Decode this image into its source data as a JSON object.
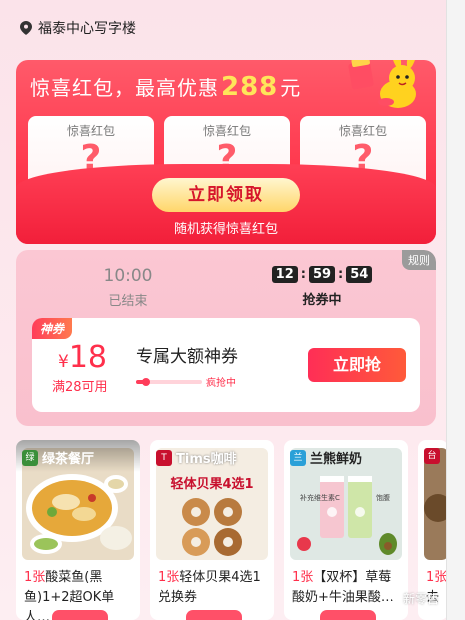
{
  "location": {
    "name": "福泰中心写字楼"
  },
  "red_packet": {
    "title_prefix": "惊喜红包，最高优惠",
    "amount": "288",
    "unit": "元",
    "slots": [
      {
        "label": "惊喜红包",
        "mystery": "?"
      },
      {
        "label": "惊喜红包",
        "mystery": "?"
      },
      {
        "label": "惊喜红包",
        "mystery": "?"
      }
    ],
    "claim_button": "立即领取",
    "subtitle": "随机获得惊喜红包"
  },
  "coupon_section": {
    "rules_label": "规则",
    "slots": [
      {
        "time": "10:00",
        "status": "已结束"
      },
      {
        "clock": [
          "12",
          "59",
          "54"
        ],
        "status": "抢券中"
      }
    ],
    "coupon": {
      "badge": "神券",
      "currency": "¥",
      "amount": "18",
      "condition": "满28可用",
      "title": "专属大额神券",
      "progress_label": "疯抢中",
      "progress_fraction": 0.15,
      "grab_button": "立即抢"
    }
  },
  "products": [
    {
      "brand": "绿茶餐厅",
      "count": "1张",
      "desc": "酸菜鱼(黑鱼)1+2超OK单人…",
      "brand_color": "#3a8f3a"
    },
    {
      "brand": "Tims咖啡",
      "count": "1张",
      "desc": "轻体贝果4选1兑换券",
      "brand_color": "#c8102e",
      "image_text": "轻体贝果4选1"
    },
    {
      "brand": "兰熊鲜奶",
      "count": "1张",
      "desc": "【双杯】草莓酸奶+牛油果酸…",
      "brand_color": "#2aa0d8",
      "tag1": "补充维生素C",
      "tag2": "饱腹"
    },
    {
      "brand": "台",
      "count": "1张",
      "desc": "去",
      "brand_color": "#c8102e"
    }
  ],
  "watermark": "新零售"
}
